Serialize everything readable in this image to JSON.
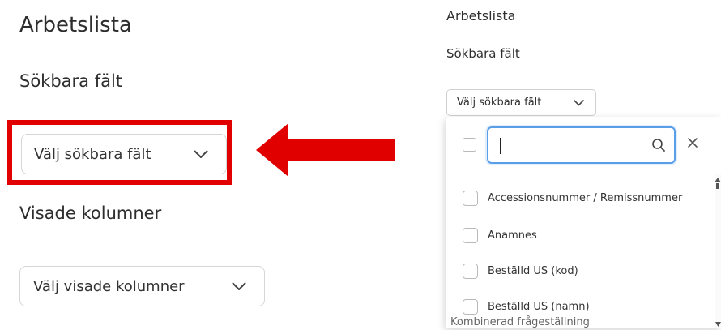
{
  "left_panel": {
    "title": "Arbetslista",
    "searchable_heading": "Sökbara fält",
    "searchable_select": "Välj sökbara fält",
    "columns_heading": "Visade kolumner",
    "columns_select": "Välj visade kolumner"
  },
  "right_panel": {
    "title": "Arbetslista",
    "searchable_heading": "Sökbara fält",
    "searchable_select": "Välj sökbara fält",
    "dropdown": {
      "search_value": "",
      "options": [
        {
          "label": "Accessionsnummer / Remissnummer"
        },
        {
          "label": "Anamnes"
        },
        {
          "label": "Beställd US (kod)"
        },
        {
          "label": "Beställd US (namn)"
        }
      ]
    },
    "partially_hidden_text": "Kombinerad frågeställning"
  },
  "colors": {
    "highlight": "#e00000",
    "focus": "#5b9ee8"
  }
}
